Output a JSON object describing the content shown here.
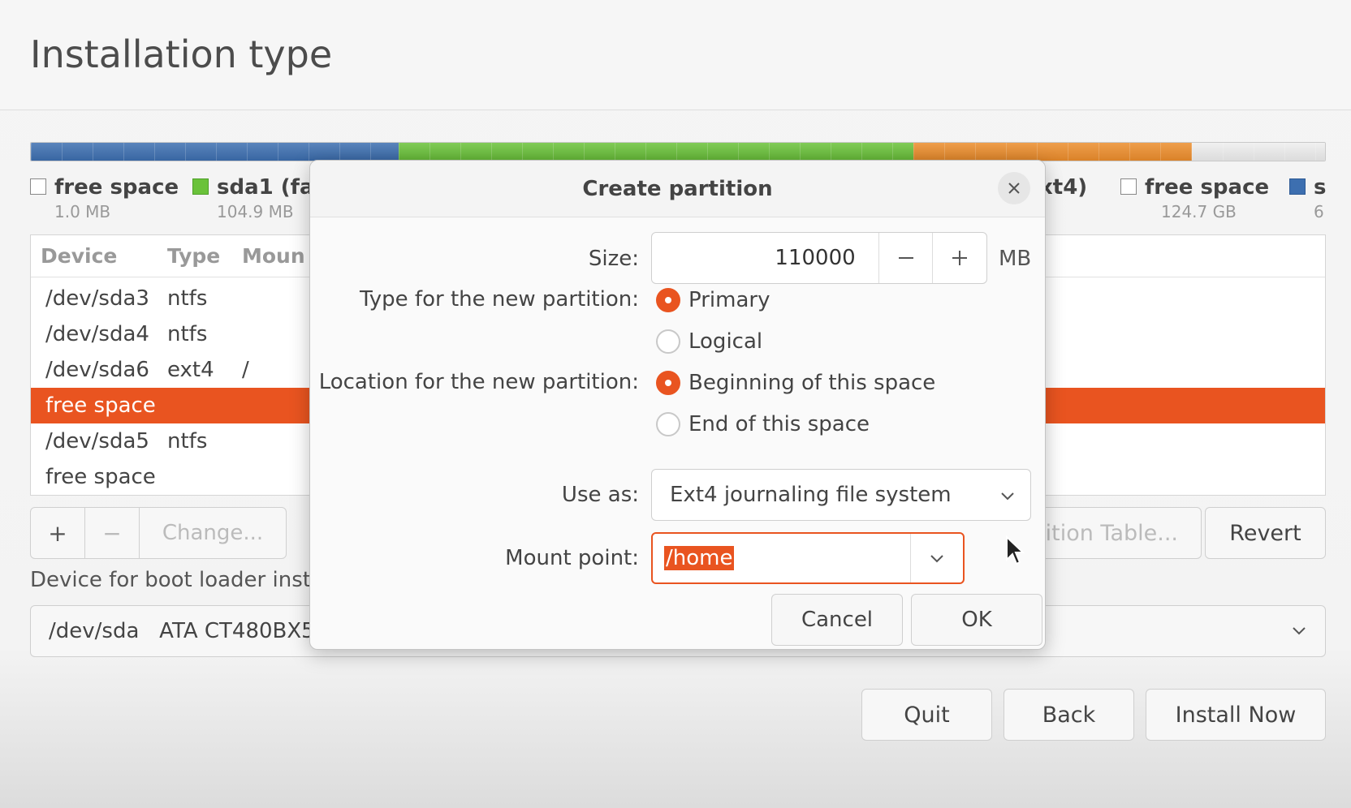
{
  "page": {
    "title": "Installation type"
  },
  "partition_bar": {
    "segments": [
      {
        "color": "#3d6fb0",
        "fraction": 0.284
      },
      {
        "color": "#6ac23a",
        "fraction": 0.398
      },
      {
        "color": "#ec8d2c",
        "fraction": 0.215
      },
      {
        "color": "#eeeeee",
        "fraction": 0.103
      }
    ]
  },
  "legend": [
    {
      "name": "free space",
      "size": "1.0 MB",
      "color": "#ffffff"
    },
    {
      "name": "sda1 (fa",
      "size": "104.9 MB",
      "color": "#6ac23a"
    },
    {
      "name": "xt4)",
      "size": "",
      "color": ""
    },
    {
      "name": "free space",
      "size": "124.7 GB",
      "color": "#ffffff"
    },
    {
      "name": "s",
      "size": "6",
      "color": "#3d6fb0"
    }
  ],
  "table": {
    "headers": {
      "device": "Device",
      "type": "Type",
      "mount": "Moun"
    },
    "rows": [
      {
        "device": "/dev/sda3",
        "type": "ntfs",
        "mount": "",
        "selected": false
      },
      {
        "device": "/dev/sda4",
        "type": "ntfs",
        "mount": "",
        "selected": false
      },
      {
        "device": "/dev/sda6",
        "type": "ext4",
        "mount": "/",
        "selected": false
      },
      {
        "device": "free space",
        "type": "",
        "mount": "",
        "selected": true
      },
      {
        "device": "/dev/sda5",
        "type": "ntfs",
        "mount": "",
        "selected": false
      },
      {
        "device": "free space",
        "type": "",
        "mount": "",
        "selected": false
      }
    ]
  },
  "toolbar": {
    "add": "+",
    "remove": "−",
    "change": "Change...",
    "new_table": "ition Table...",
    "revert": "Revert"
  },
  "bootloader": {
    "label": "Device for boot loader inst",
    "value": "/dev/sda   ATA CT480BX5"
  },
  "footer": {
    "quit": "Quit",
    "back": "Back",
    "install": "Install Now"
  },
  "dialog": {
    "title": "Create partition",
    "size_label": "Size:",
    "size_value": "110000",
    "size_unit": "MB",
    "minus": "−",
    "plus": "+",
    "type_label": "Type for the new partition:",
    "type_primary": "Primary",
    "type_logical": "Logical",
    "location_label": "Location for the new partition:",
    "location_begin": "Beginning of this space",
    "location_end": "End of this space",
    "use_as_label": "Use as:",
    "use_as_value": "Ext4 journaling file system",
    "mount_label": "Mount point:",
    "mount_value": "/home",
    "cancel": "Cancel",
    "ok": "OK"
  },
  "colors": {
    "accent": "#e95420"
  }
}
